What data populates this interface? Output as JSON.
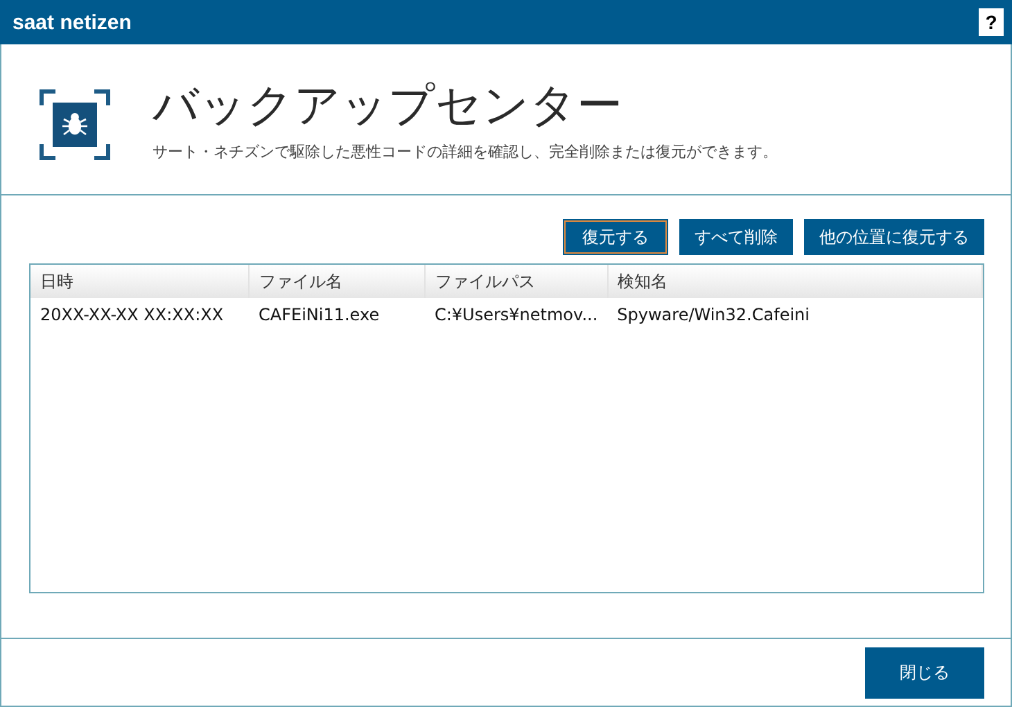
{
  "window": {
    "title": "saat netizen",
    "help": "?"
  },
  "header": {
    "title": "バックアップセンター",
    "subtitle": "サート・ネチズンで駆除した悪性コードの詳細を確認し、完全削除または復元ができます。"
  },
  "actions": [
    {
      "label": "復元する",
      "focused": true
    },
    {
      "label": "すべて削除",
      "focused": false
    },
    {
      "label": "他の位置に復元する",
      "focused": false
    }
  ],
  "table": {
    "columns": [
      "日時",
      "ファイル名",
      "ファイルパス",
      "検知名"
    ],
    "rows": [
      [
        "20XX-XX-XX XX:XX:XX",
        "CAFEiNi11.exe",
        "C:¥Users¥netmov...",
        "Spyware/Win32.Cafeini"
      ]
    ]
  },
  "footer": {
    "close": "閉じる"
  }
}
